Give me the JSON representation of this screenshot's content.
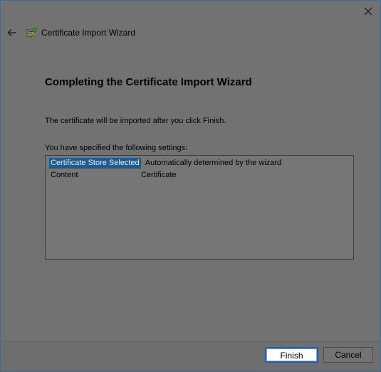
{
  "window": {
    "title": "Certificate Import Wizard"
  },
  "page": {
    "heading": "Completing the Certificate Import Wizard",
    "intro": "The certificate will be imported after you click Finish.",
    "settings_label": "You have specified the following settings:",
    "settings": [
      {
        "key": "Certificate Store Selected",
        "value": "Automatically determined by the wizard"
      },
      {
        "key": "Content",
        "value": "Certificate"
      }
    ]
  },
  "buttons": {
    "finish": "Finish",
    "cancel": "Cancel"
  },
  "icons": {
    "close": "close-icon",
    "back": "back-arrow-icon",
    "app": "certificate-icon"
  },
  "colors": {
    "selection": "#1f5a92",
    "primary_button_border": "#1f5fb0"
  }
}
